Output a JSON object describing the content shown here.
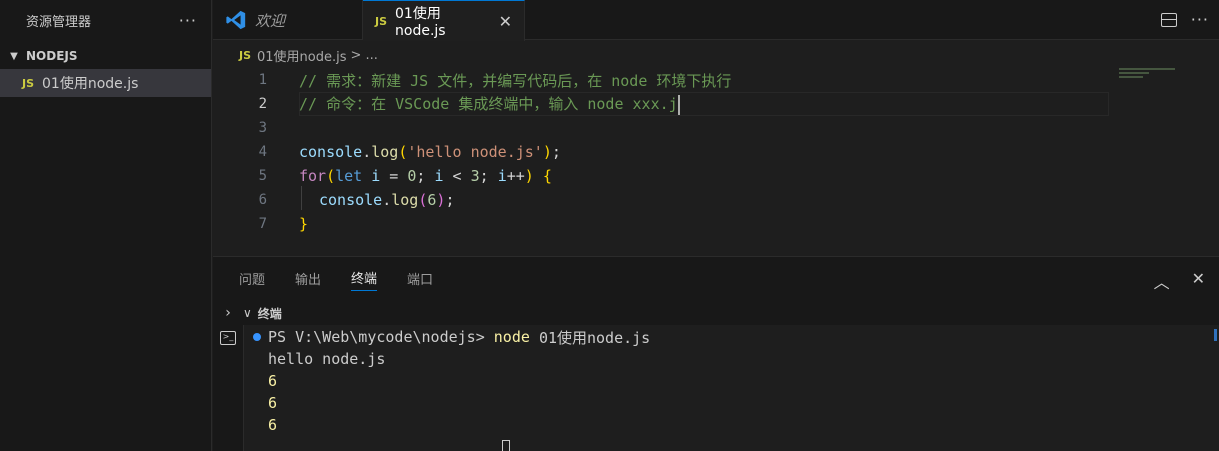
{
  "sidebar": {
    "title": "资源管理器",
    "more": "···",
    "section": "NODEJS",
    "file": {
      "icon": "JS",
      "name": "01使用node.js"
    }
  },
  "tabs": {
    "welcome": "欢迎",
    "active": {
      "icon": "JS",
      "label": "01使用node.js",
      "close": "✕"
    },
    "more": "···"
  },
  "breadcrumb": {
    "icon": "JS",
    "file": "01使用node.js",
    "sep": ">",
    "more": "..."
  },
  "editor": {
    "line_numbers": [
      "1",
      "2",
      "3",
      "4",
      "5",
      "6",
      "7"
    ],
    "line1": "// 需求：新建 JS 文件，并编写代码后，在 node 环境下执行",
    "line2": "// 命令：在 VSCode 集成终端中，输入 node xxx.j",
    "line4": {
      "obj": "console",
      "dot": ".",
      "fn": "log",
      "p1": "(",
      "str": "'hello node.js'",
      "p2": ")",
      "semi": ";"
    },
    "line5": {
      "kw": "for",
      "p1": "(",
      "let": "let",
      "v1": " i",
      "eq": " = ",
      "n0": "0",
      "s1": "; ",
      "v2": "i",
      "lt": " < ",
      "n3": "3",
      "s2": "; ",
      "v3": "i",
      "inc": "++",
      "p2": ")",
      "brace": " {"
    },
    "line6": {
      "obj": "console",
      "dot": ".",
      "fn": "log",
      "p1": "(",
      "num": "6",
      "p2": ")",
      "semi": ";"
    },
    "line7": "}"
  },
  "panel": {
    "tabs": [
      "问题",
      "输出",
      "终端",
      "端口"
    ],
    "active_tab": "终端",
    "terminal_label": "终端",
    "up": "︿",
    "close": "✕",
    "lines": {
      "prompt": "PS V:\\Web\\mycode\\nodejs> ",
      "cmd": "node ",
      "cmd_arg": "01使用node.js",
      "out1": "hello node.js",
      "out2": "6",
      "out3": "6",
      "out4": "6"
    }
  },
  "colors": {
    "accent": "#0078d4",
    "js_icon": "#cbcb41",
    "comment": "#6a9955"
  }
}
